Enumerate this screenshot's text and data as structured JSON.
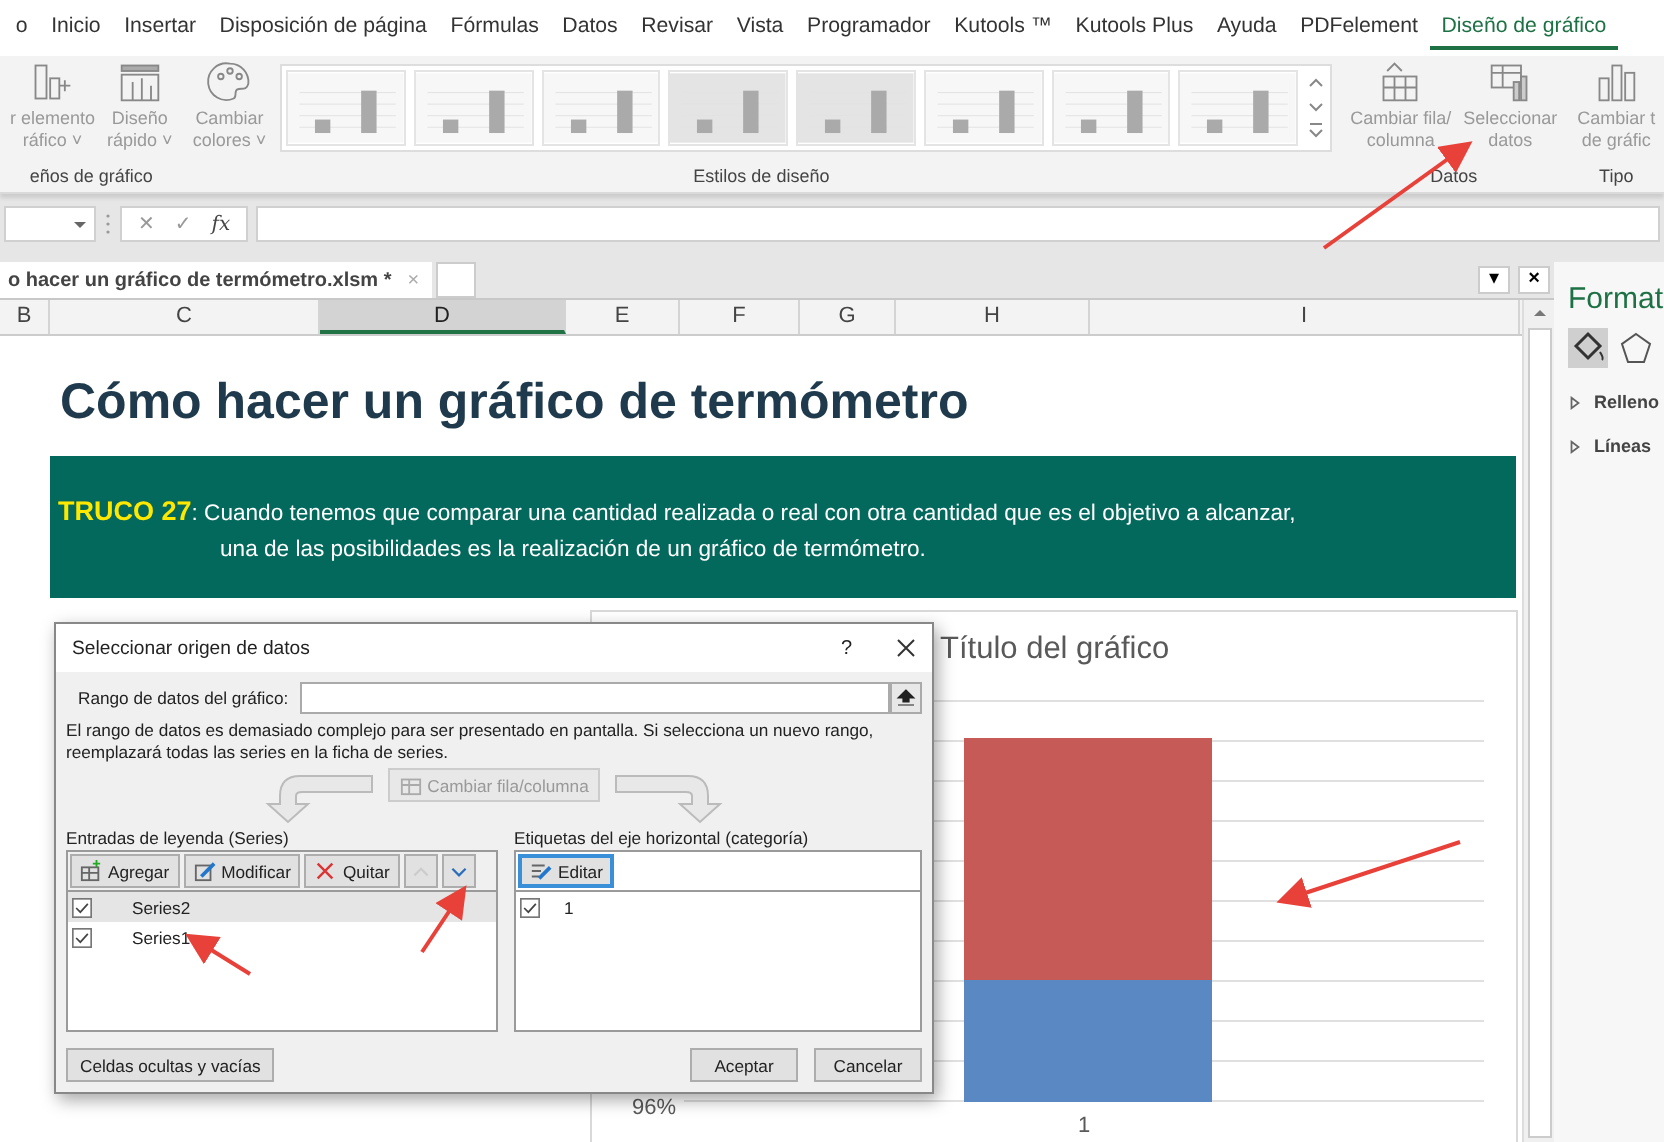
{
  "menu_tabs": [
    {
      "label": "o",
      "selected": false
    },
    {
      "label": "Inicio",
      "selected": false
    },
    {
      "label": "Insertar",
      "selected": false
    },
    {
      "label": "Disposición de página",
      "selected": false
    },
    {
      "label": "Fórmulas",
      "selected": false
    },
    {
      "label": "Datos",
      "selected": false
    },
    {
      "label": "Revisar",
      "selected": false
    },
    {
      "label": "Vista",
      "selected": false
    },
    {
      "label": "Programador",
      "selected": false
    },
    {
      "label": "Kutools ™",
      "selected": false
    },
    {
      "label": "Kutools Plus",
      "selected": false
    },
    {
      "label": "Ayuda",
      "selected": false
    },
    {
      "label": "PDFelement",
      "selected": false
    },
    {
      "label": "Diseño de gráfico",
      "selected": true
    }
  ],
  "ribbon": {
    "groups": [
      {
        "label": "eños de gráfico",
        "kind": "plain",
        "buttons": [
          {
            "kind": "add-element",
            "lines": [
              "r elemento",
              "ráfico ˅"
            ],
            "disabled": true
          },
          {
            "kind": "layout",
            "lines": [
              "Diseño",
              "rápido ˅"
            ],
            "disabled": true
          }
        ]
      },
      {
        "label": "Estilos de diseño",
        "kind": "styles",
        "buttons": [
          {
            "kind": "colors",
            "lines": [
              "Cambiar",
              "colores ˅"
            ],
            "disabled": true
          }
        ]
      },
      {
        "label": "Datos",
        "kind": "plain",
        "buttons": [
          {
            "kind": "switch",
            "lines": [
              "Cambiar fila/",
              "columna"
            ],
            "disabled": true
          },
          {
            "kind": "select",
            "lines": [
              "Seleccionar",
              "datos"
            ],
            "disabled": true
          }
        ]
      },
      {
        "label": "Tipo",
        "kind": "plain",
        "buttons": [
          {
            "kind": "type",
            "lines": [
              "Cambiar t",
              "de gráfic"
            ],
            "disabled": true
          }
        ]
      }
    ]
  },
  "formula_bar": {
    "cancel": "✕",
    "enter": "✓",
    "function": "fx"
  },
  "workbook_tab": {
    "name": "o hacer un gráfico de termómetro.xlsm *",
    "close": "×"
  },
  "pane_controls": {
    "menu": "▾",
    "close": "×"
  },
  "columns": [
    {
      "label": "B",
      "selected": false
    },
    {
      "label": "C",
      "selected": false
    },
    {
      "label": "D",
      "selected": true
    },
    {
      "label": "E",
      "selected": false
    },
    {
      "label": "F",
      "selected": false
    },
    {
      "label": "G",
      "selected": false
    },
    {
      "label": "H",
      "selected": false
    },
    {
      "label": "I",
      "selected": false
    }
  ],
  "sheet": {
    "title": "Cómo hacer un gráfico de termómetro",
    "tip": {
      "label": "TRUCO 27",
      "lines": [
        ": Cuando tenemos que comparar una cantidad realizada o real con otra cantidad que es el objetivo a alcanzar,",
        "una de las posibilidades es la realización de un gráfico de termómetro."
      ]
    }
  },
  "chart": {
    "title": "Título del gráfico",
    "y_tick": "96%",
    "category": "1"
  },
  "format_pane": {
    "title": "Format",
    "sections": [
      {
        "label": "Relleno",
        "expanded": false
      },
      {
        "label": "Líneas",
        "expanded": false
      }
    ]
  },
  "dialog": {
    "title": "Seleccionar origen de datos",
    "help": "?",
    "range_label": "Rango de datos del gráfico:",
    "message": "El rango de datos es demasiado complejo para ser presentado en pantalla. Si selecciona un nuevo rango, reemplazará todas las series en la ficha de series.",
    "switch_button": {
      "label": "Cambiar fila/columna",
      "disabled": true
    },
    "legend": {
      "label": "Entradas de leyenda (Series)",
      "buttons": [
        {
          "kind": "add",
          "label": "Agregar"
        },
        {
          "kind": "edit",
          "label": "Modificar"
        },
        {
          "kind": "remove",
          "label": "Quitar"
        }
      ],
      "move_up_disabled": true,
      "move_down_disabled": false,
      "series": [
        {
          "name": "Series2",
          "checked": true,
          "selected": true
        },
        {
          "name": "Series1",
          "checked": true,
          "selected": false
        }
      ]
    },
    "axis": {
      "label": "Etiquetas del eje horizontal (categoría)",
      "edit_button": "Editar",
      "items": [
        {
          "name": "1",
          "checked": true
        }
      ]
    },
    "hidden_cells_button": "Celdas ocultas y vacías",
    "ok_button": "Aceptar",
    "cancel_button": "Cancelar"
  }
}
